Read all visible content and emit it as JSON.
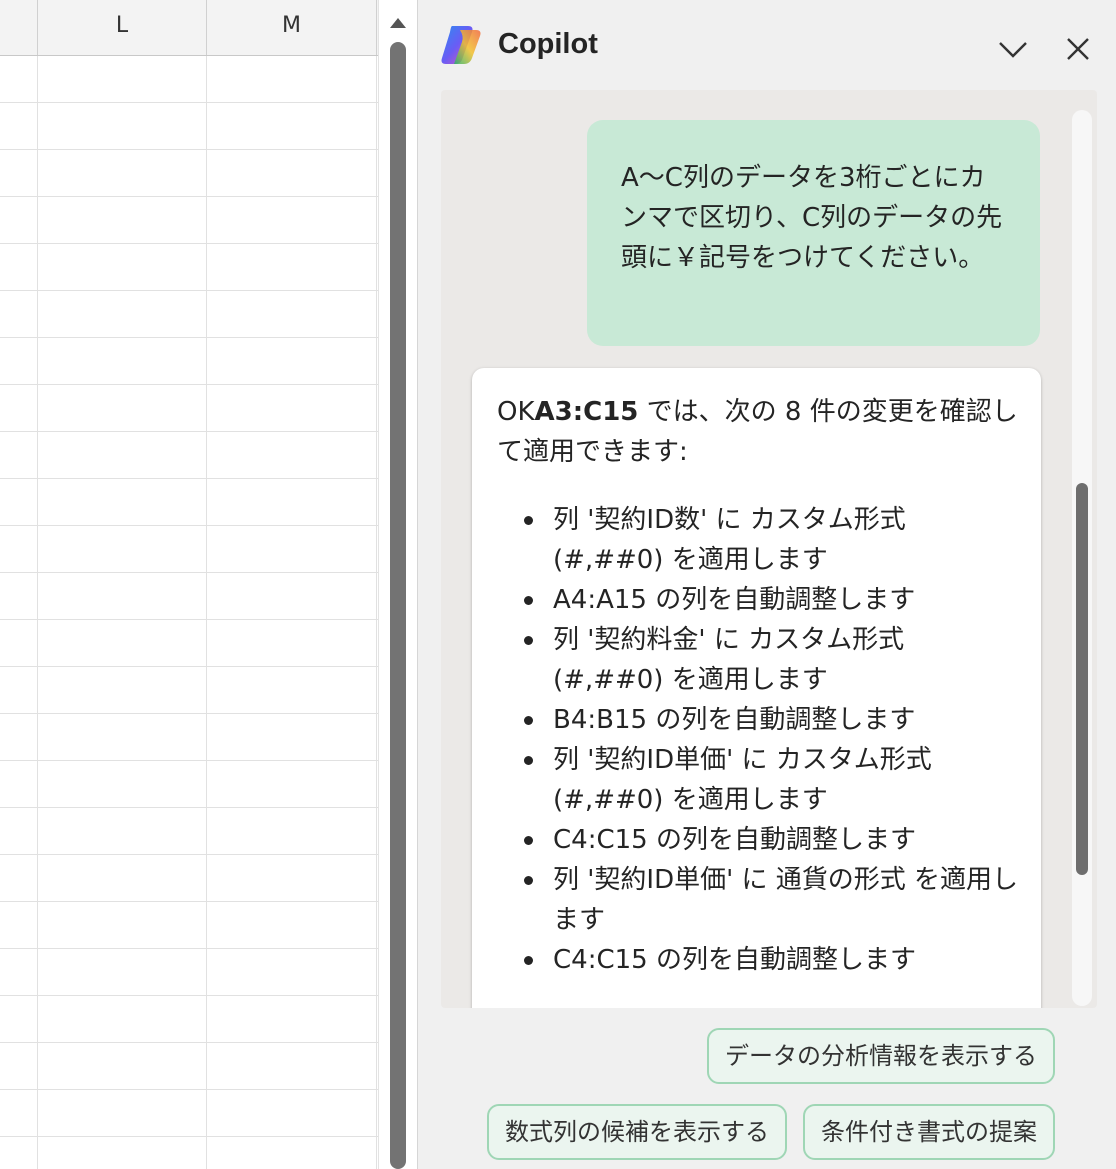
{
  "spreadsheet": {
    "column_headers": [
      "L",
      "M"
    ],
    "row_count": 24
  },
  "copilot": {
    "title": "Copilot",
    "icons": {
      "logo": "copilot-logo-icon",
      "collapse": "chevron-down-icon",
      "close": "close-icon"
    },
    "user_message": "A～C列のデータを3桁ごとにカンマで区切り、C列のデータの先頭に￥記号をつけてください。",
    "reply": {
      "prefix": "OK",
      "range": "A3:C15",
      "intro_rest": " では、次の 8 件の変更を確認して適用できます:",
      "items": [
        "列 '契約ID数' に カスタム形式 (#,##0) を適用します",
        "A4:A15 の列を自動調整します",
        "列 '契約料金' に カスタム形式 (#,##0) を適用します",
        "B4:B15 の列を自動調整します",
        "列 '契約ID単価' に カスタム形式 (#,##0) を適用します",
        "C4:C15 の列を自動調整します",
        "列 '契約ID単価' に 通貨の形式 を適用します",
        "C4:C15 の列を自動調整します"
      ]
    },
    "suggestions": [
      "データの分析情報を表示する",
      "数式列の候補を表示する",
      "条件付き書式の提案"
    ]
  }
}
